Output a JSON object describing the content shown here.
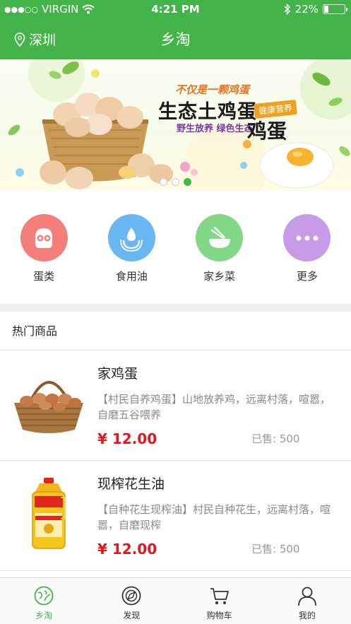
{
  "status_bar": {
    "carrier": "VIRGIN",
    "time": "4:21 PM",
    "battery": "22%",
    "battery_level": 0.22,
    "signal_dots": "●●●○○"
  },
  "nav": {
    "location": "深圳",
    "title": "乡淘"
  },
  "banner": {
    "line1": "不仅是一颗鸡蛋",
    "line2": "生态土鸡蛋",
    "badge": "健康营养",
    "line3": "野生放养 绿色生态",
    "line4": "鸡蛋",
    "pages": 3,
    "active_page": 2
  },
  "categories": [
    {
      "label": "蛋类",
      "color": "#f47e7a",
      "icon": "egg-face-icon"
    },
    {
      "label": "食用油",
      "color": "#68b6f2",
      "icon": "oil-drop-icon"
    },
    {
      "label": "家乡菜",
      "color": "#82d887",
      "icon": "bowl-chopsticks-icon"
    },
    {
      "label": "更多",
      "color": "#c79be8",
      "icon": "more-dots-icon"
    }
  ],
  "hot": {
    "title": "热门商品",
    "items": [
      {
        "name": "家鸡蛋",
        "desc": "【村民自养鸡蛋】山地放养鸡，远离村落，喧嚣，自磨五谷喂养",
        "price": "¥ 12.00",
        "sold": "已售: 500",
        "image": "egg-basket"
      },
      {
        "name": "现榨花生油",
        "desc": "【自种花生现榨油】村民自种花生，远离村落，喧嚣，自磨现榨",
        "price": "¥ 12.00",
        "sold": "已售: 500",
        "image": "oil-bottle"
      }
    ]
  },
  "tabs": [
    {
      "label": "乡淘",
      "icon": "globe-leaf-icon",
      "active": true
    },
    {
      "label": "发现",
      "icon": "compass-icon",
      "active": false
    },
    {
      "label": "购物车",
      "icon": "cart-icon",
      "active": false
    },
    {
      "label": "我的",
      "icon": "user-icon",
      "active": false
    }
  ],
  "colors": {
    "primary": "#43b449",
    "price": "#e8141b"
  }
}
